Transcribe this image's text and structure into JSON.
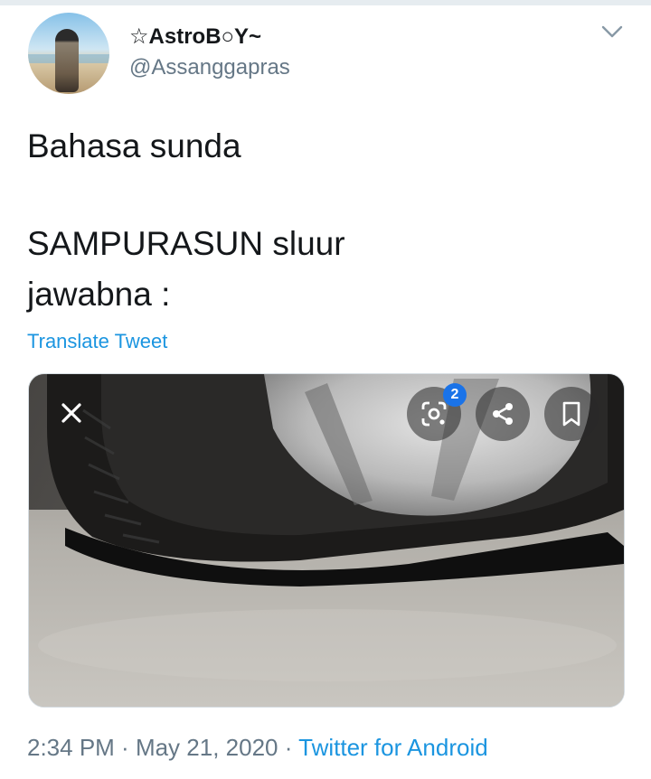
{
  "user": {
    "display_name": "☆AstroB○Y~",
    "handle": "@Assanggapras"
  },
  "tweet": {
    "lines": [
      "Bahasa sunda",
      "SAMPURASUN sluur",
      "jawabna :"
    ],
    "translate_label": "Translate Tweet"
  },
  "media": {
    "overlay": {
      "lens_badge": "2",
      "icons": [
        "close-icon",
        "lens-icon",
        "share-icon",
        "bookmark-icon"
      ]
    }
  },
  "meta": {
    "time": "2:34 PM",
    "separator": " · ",
    "date": "May 21, 2020",
    "source": "Twitter for Android"
  },
  "colors": {
    "link": "#1b95e0",
    "secondary_text": "#657786",
    "badge": "#1a73e8"
  }
}
